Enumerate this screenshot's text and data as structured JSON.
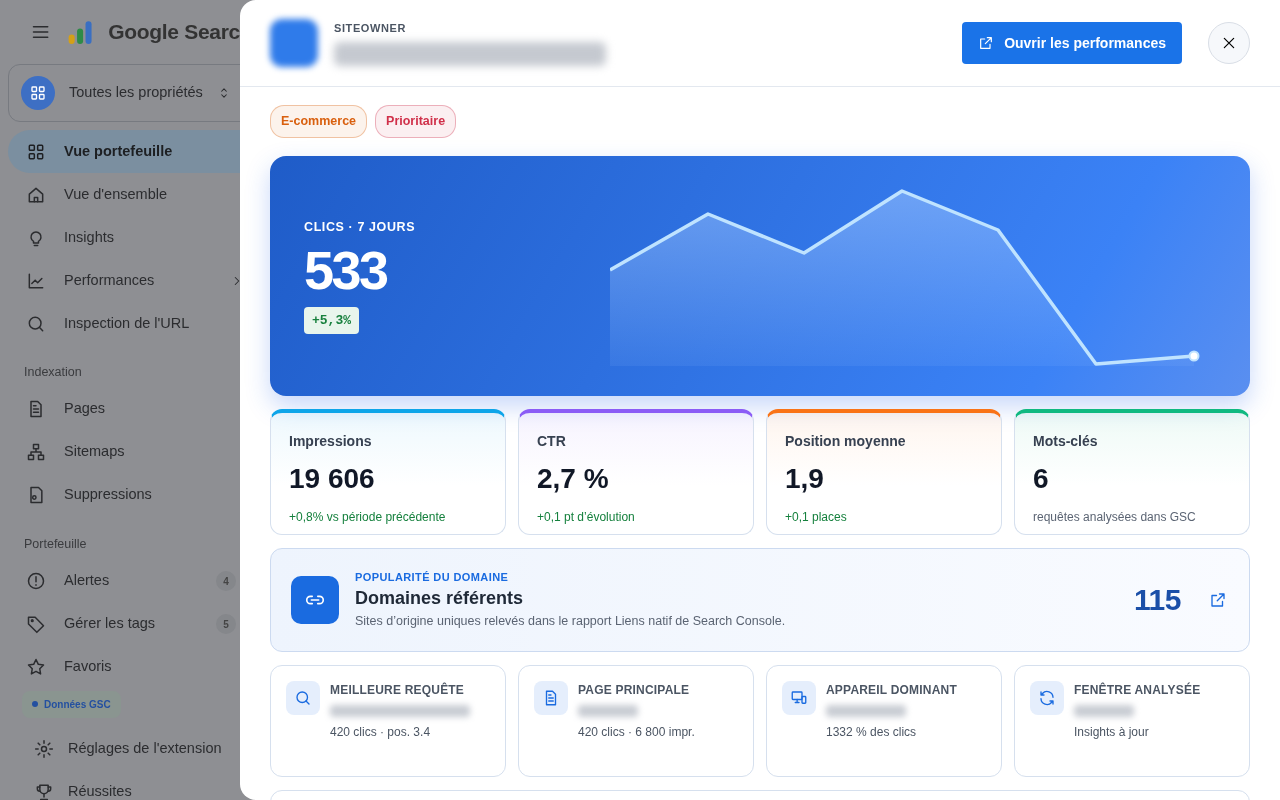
{
  "sidebar": {
    "brand": "Google Searc",
    "property": "Toutes les propriétés",
    "groups": [
      {
        "items": [
          {
            "label": "Vue portefeuille",
            "selected": true,
            "submenu": false
          },
          {
            "label": "Vue d'ensemble",
            "selected": false,
            "submenu": false
          },
          {
            "label": "Insights",
            "selected": false,
            "submenu": false
          },
          {
            "label": "Performances",
            "selected": false,
            "submenu": true
          },
          {
            "label": "Inspection de l'URL",
            "selected": false,
            "submenu": false
          }
        ]
      },
      {
        "heading": "Indexation",
        "items": [
          {
            "label": "Pages",
            "selected": false,
            "submenu": false
          },
          {
            "label": "Sitemaps",
            "selected": false,
            "submenu": false
          },
          {
            "label": "Suppressions",
            "selected": false,
            "submenu": false
          }
        ]
      },
      {
        "heading": "Portefeuille",
        "items": [
          {
            "label": "Alertes",
            "selected": false,
            "submenu": false,
            "count": "4"
          },
          {
            "label": "Gérer les tags",
            "selected": false,
            "submenu": false,
            "count": "5"
          },
          {
            "label": "Favoris",
            "selected": false,
            "submenu": false
          }
        ]
      }
    ],
    "status_pill": "Données GSC",
    "footer_items": [
      {
        "label": "Réglages de l'extension",
        "selected": false,
        "submenu": false
      },
      {
        "label": "Réussites",
        "selected": false,
        "submenu": false
      }
    ]
  },
  "panel": {
    "eyebrow": "SITEOWNER",
    "open_button": "Ouvrir les performances",
    "tags": [
      {
        "label": "E-commerce",
        "color": "#d9600f"
      },
      {
        "label": "Prioritaire",
        "color": "#d0304a"
      }
    ],
    "hero": {
      "label": "CLICS · 7 JOURS",
      "value": "533",
      "delta": "+5,3%"
    },
    "stats": [
      {
        "label": "Impressions",
        "value": "19 606",
        "note": "+0,8% vs période précédente",
        "kind": "up",
        "color": "#0ea5e9"
      },
      {
        "label": "CTR",
        "value": "2,7 %",
        "note": "+0,1 pt d’évolution",
        "kind": "up",
        "color": "#8b5cf6"
      },
      {
        "label": "Position moyenne",
        "value": "1,9",
        "note": "+0,1 places",
        "kind": "up",
        "color": "#f97316"
      },
      {
        "label": "Mots-clés",
        "value": "6",
        "note": "requêtes analysées dans GSC",
        "kind": "neutral",
        "color": "#10b981"
      }
    ],
    "domain": {
      "eyebrow": "POPULARITÉ DU DOMAINE",
      "title": "Domaines référents",
      "description": "Sites d’origine uniques relevés dans le rapport Liens natif de Search Console.",
      "value": "115"
    },
    "info_cards": [
      {
        "label": "MEILLEURE REQUÊTE",
        "detail": "420 clics · pos. 3.4"
      },
      {
        "label": "PAGE PRINCIPALE",
        "detail": "420 clics · 6 800 impr."
      },
      {
        "label": "APPAREIL DOMINANT",
        "detail": "1332 % des clics"
      },
      {
        "label": "FENÊTRE ANALYSÉE",
        "detail": "Insights à jour"
      }
    ]
  }
}
